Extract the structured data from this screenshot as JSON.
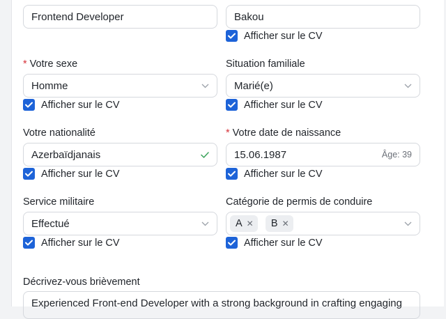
{
  "row1": {
    "position_value": "Frontend Developer",
    "city_value": "Bakou",
    "city_show_label": "Afficher sur le CV"
  },
  "gender": {
    "label": "Votre sexe",
    "value": "Homme",
    "show_label": "Afficher sur le CV"
  },
  "family": {
    "label": "Situation familiale",
    "value": "Marié(e)",
    "show_label": "Afficher sur le CV"
  },
  "nationality": {
    "label": "Votre nationalité",
    "value": "Azerbaïdjanais",
    "show_label": "Afficher sur le CV"
  },
  "birthdate": {
    "label": "Votre date de naissance",
    "value": "15.06.1987",
    "age_text": "Âge: 39",
    "show_label": "Afficher sur le CV"
  },
  "military": {
    "label": "Service militaire",
    "value": "Effectué",
    "show_label": "Afficher sur le CV"
  },
  "license": {
    "label": "Catégorie de permis de conduire",
    "tags": [
      "A",
      "B"
    ],
    "show_label": "Afficher sur le CV"
  },
  "about": {
    "label": "Décrivez-vous brièvement",
    "value": "Experienced Front-end Developer with a strong background in crafting engaging"
  },
  "required_mark": "*",
  "colors": {
    "checkbox": "#1d63d8",
    "required": "#d6323a",
    "valid": "#3aa35a"
  },
  "icons": {
    "chevron": "chevron-down-icon",
    "valid": "checkmark-icon",
    "remove": "close-icon",
    "checkbox": "checkbox-checked-icon"
  }
}
